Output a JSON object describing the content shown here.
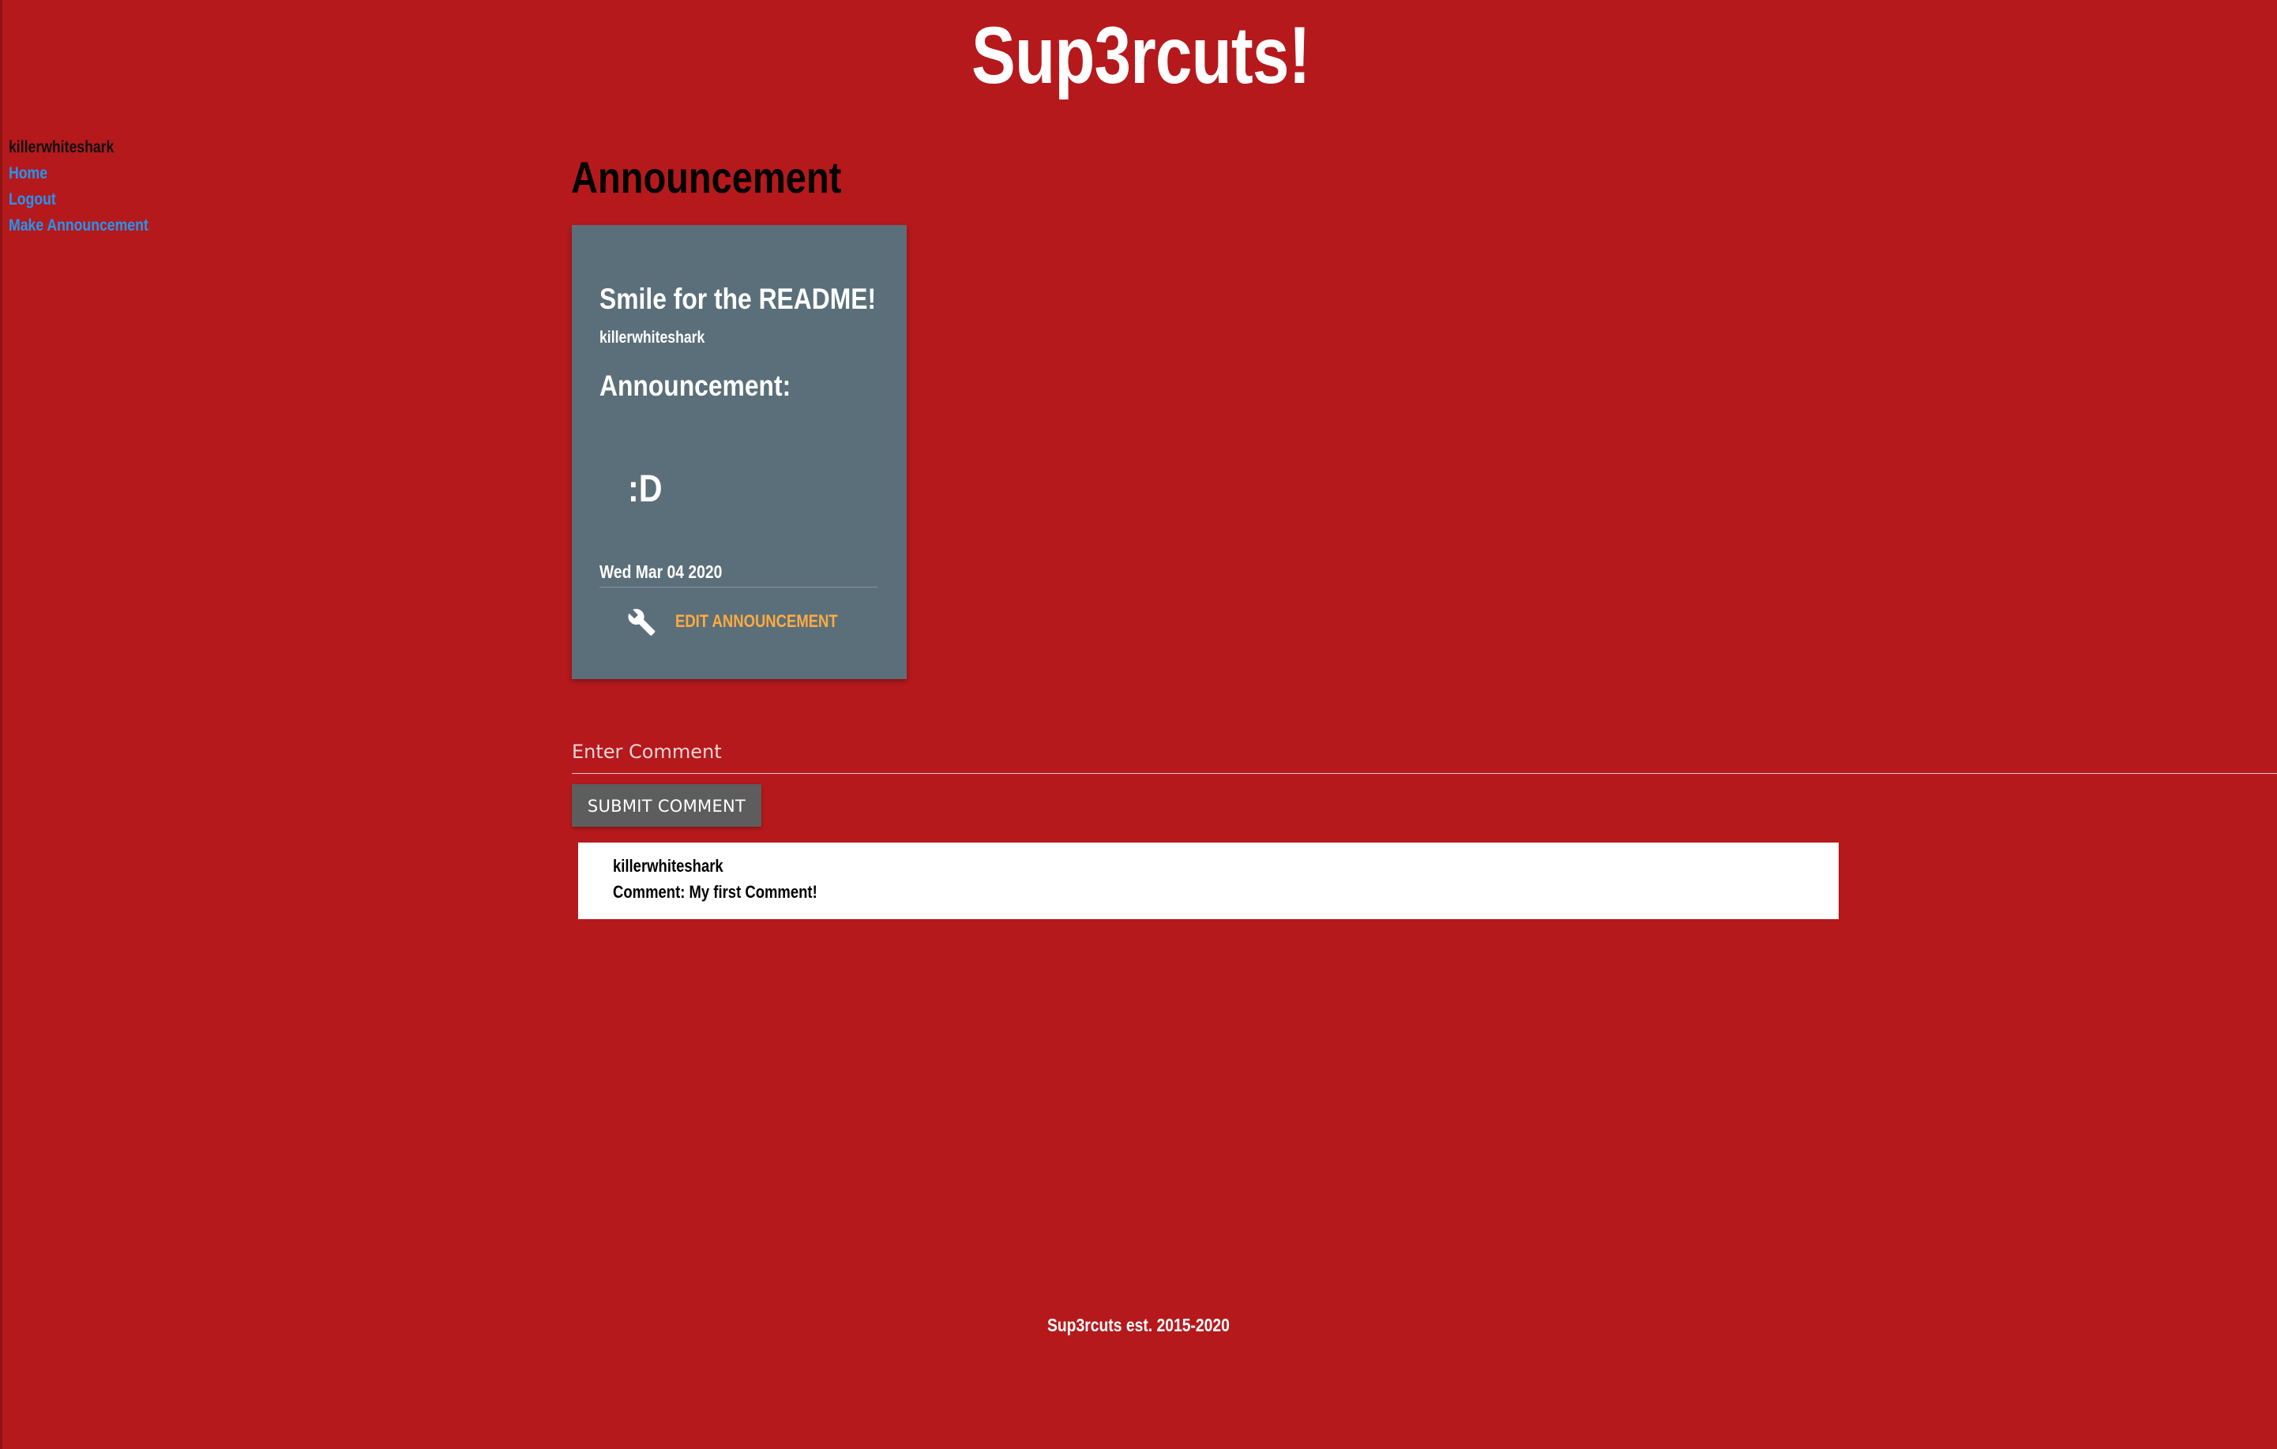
{
  "colors": {
    "page_background": "#b5191c",
    "card_background": "#5a6f7a",
    "link": "#2196f3",
    "action": "#ffab40",
    "button": "#5d5d5d"
  },
  "site": {
    "title": "Sup3rcuts!"
  },
  "sidebar": {
    "username": "killerwhiteshark",
    "links": [
      {
        "label": "Home"
      },
      {
        "label": "Logout"
      },
      {
        "label": "Make Announcement"
      }
    ]
  },
  "main": {
    "title": "Announcement"
  },
  "announcement": {
    "title": "Smile for the README!",
    "author": "killerwhiteshark",
    "label": "Announcement:",
    "body": ":D",
    "date": "Wed Mar 04 2020",
    "action_label": "EDIT ANNOUNCEMENT",
    "action_icon": "wrench-icon"
  },
  "comment_form": {
    "placeholder": "Enter Comment",
    "value": "",
    "submit_label": "SUBMIT COMMENT"
  },
  "comments": [
    {
      "author": "killerwhiteshark",
      "text": "Comment: My first Comment!"
    }
  ],
  "footer": {
    "text": "Sup3rcuts est. 2015-2020"
  }
}
